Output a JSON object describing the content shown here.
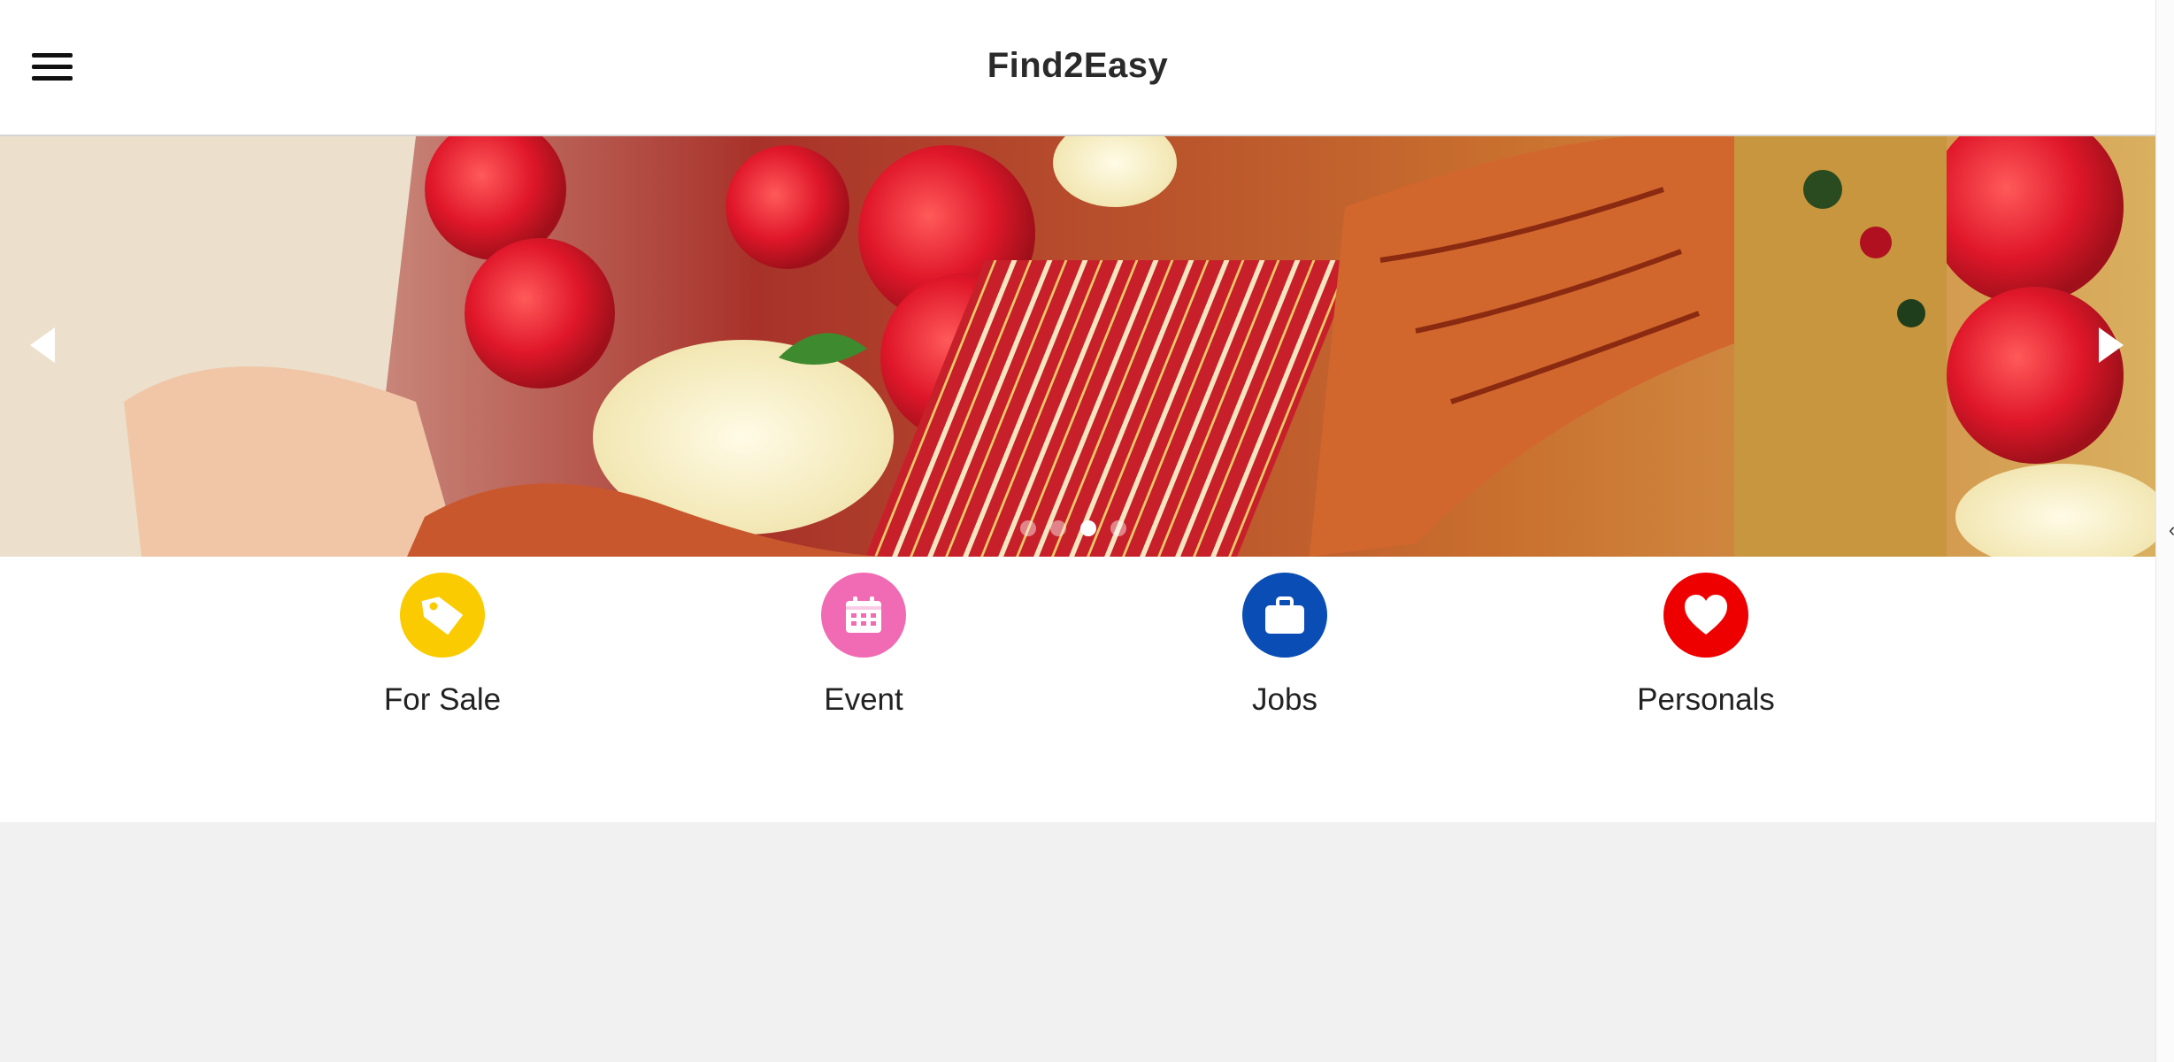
{
  "header": {
    "title": "Find2Easy",
    "menu_icon": "hamburger-menu-icon"
  },
  "carousel": {
    "slide_count": 4,
    "active_index": 2,
    "prev_icon": "chevron-left-icon",
    "next_icon": "chevron-right-icon"
  },
  "categories": [
    {
      "label": "For Sale",
      "icon": "tag-icon",
      "color": "#f9cb00"
    },
    {
      "label": "Event",
      "icon": "calendar-icon",
      "color": "#f06bb3"
    },
    {
      "label": "Jobs",
      "icon": "briefcase-icon",
      "color": "#0a4db4"
    },
    {
      "label": "Personals",
      "icon": "heart-icon",
      "color": "#ee0000"
    }
  ],
  "colors": {
    "background": "#f1f1f1",
    "header_bg": "#ffffff",
    "title_text": "#2a2a2a"
  }
}
